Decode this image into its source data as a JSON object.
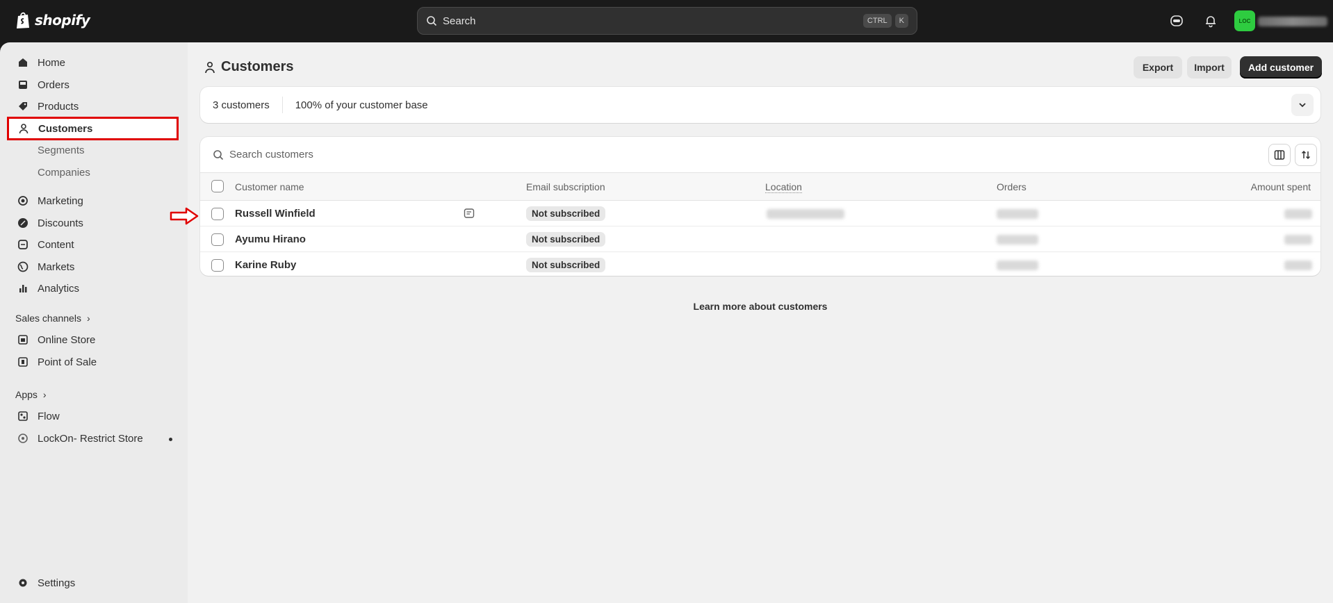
{
  "topbar": {
    "brand": "shopify",
    "search_placeholder": "Search",
    "shortcut_ctrl": "CTRL",
    "shortcut_key": "K",
    "avatar_initials": "LOC"
  },
  "sidebar": {
    "items": [
      {
        "label": "Home",
        "icon": "home-icon"
      },
      {
        "label": "Orders",
        "icon": "inbox-icon"
      },
      {
        "label": "Products",
        "icon": "tag-icon"
      },
      {
        "label": "Customers",
        "icon": "person-icon"
      },
      {
        "label": "Segments"
      },
      {
        "label": "Companies"
      },
      {
        "label": "Marketing",
        "icon": "target-icon"
      },
      {
        "label": "Discounts",
        "icon": "discount-icon"
      },
      {
        "label": "Content",
        "icon": "content-icon"
      },
      {
        "label": "Markets",
        "icon": "globe-icon"
      },
      {
        "label": "Analytics",
        "icon": "bar-chart-icon"
      }
    ],
    "sales_channels_label": "Sales channels",
    "sales_channels": [
      {
        "label": "Online Store",
        "icon": "store-icon"
      },
      {
        "label": "Point of Sale",
        "icon": "pos-icon"
      }
    ],
    "apps_label": "Apps",
    "apps": [
      {
        "label": "Flow",
        "icon": "flow-icon"
      },
      {
        "label": "LockOn- Restrict Store",
        "icon": "lockon-icon"
      }
    ],
    "settings_label": "Settings"
  },
  "main": {
    "title": "Customers",
    "buttons": {
      "export": "Export",
      "import": "Import",
      "add": "Add customer"
    },
    "summary": {
      "count": "3 customers",
      "base": "100% of your customer base"
    },
    "table": {
      "search_placeholder": "Search customers",
      "columns": [
        "Customer name",
        "Email subscription",
        "Location",
        "Orders",
        "Amount spent"
      ],
      "rows": [
        {
          "name": "Russell Winfield",
          "email": "Not subscribed",
          "has_note": true
        },
        {
          "name": "Ayumu Hirano",
          "email": "Not subscribed",
          "has_note": false
        },
        {
          "name": "Karine Ruby",
          "email": "Not subscribed",
          "has_note": false
        }
      ]
    },
    "learn_more": "Learn more about customers"
  },
  "colors": {
    "highlight": "#e00000",
    "avatar": "#2ecc40",
    "primary": "#303030"
  }
}
